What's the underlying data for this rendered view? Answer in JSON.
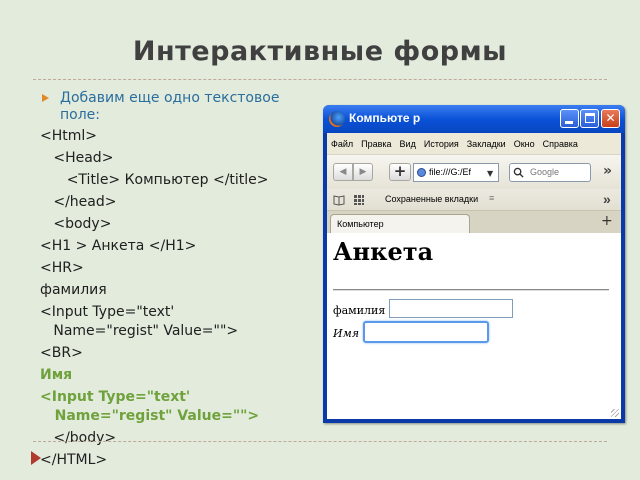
{
  "slide": {
    "title": "Интерактивные формы",
    "bullet": "Добавим еще одно текстовое поле:",
    "code_lines": [
      "<Html>",
      "   <Head>",
      "      <Title> Компьютер </title>",
      "   </head>",
      "   <body>",
      "<H1 > Анкета </H1>",
      "<HR>",
      "фамилия",
      "<Input Type=\"text'\n   Name=\"regist\" Value=\"\">",
      "<BR>"
    ],
    "highlight_lines": [
      "Имя",
      "<Input Type=\"text'\n   Name=\"regist\" Value=\"\">"
    ],
    "tail_lines": [
      "   </body>",
      "</HTML>"
    ]
  },
  "browser": {
    "title": "Компьюте р",
    "menu": [
      "Файл",
      "Правка",
      "Вид",
      "История",
      "Закладки",
      "Окно",
      "Справка"
    ],
    "url": "file:///G:/Ef",
    "search_placeholder": "Google",
    "bookmarks_label": "Сохраненные вкладки",
    "tab_label": "Компьютер",
    "page_heading": "Анкета",
    "field1_label": "фамилия",
    "field2_label": "Имя",
    "field1_value": "",
    "field2_value": ""
  }
}
